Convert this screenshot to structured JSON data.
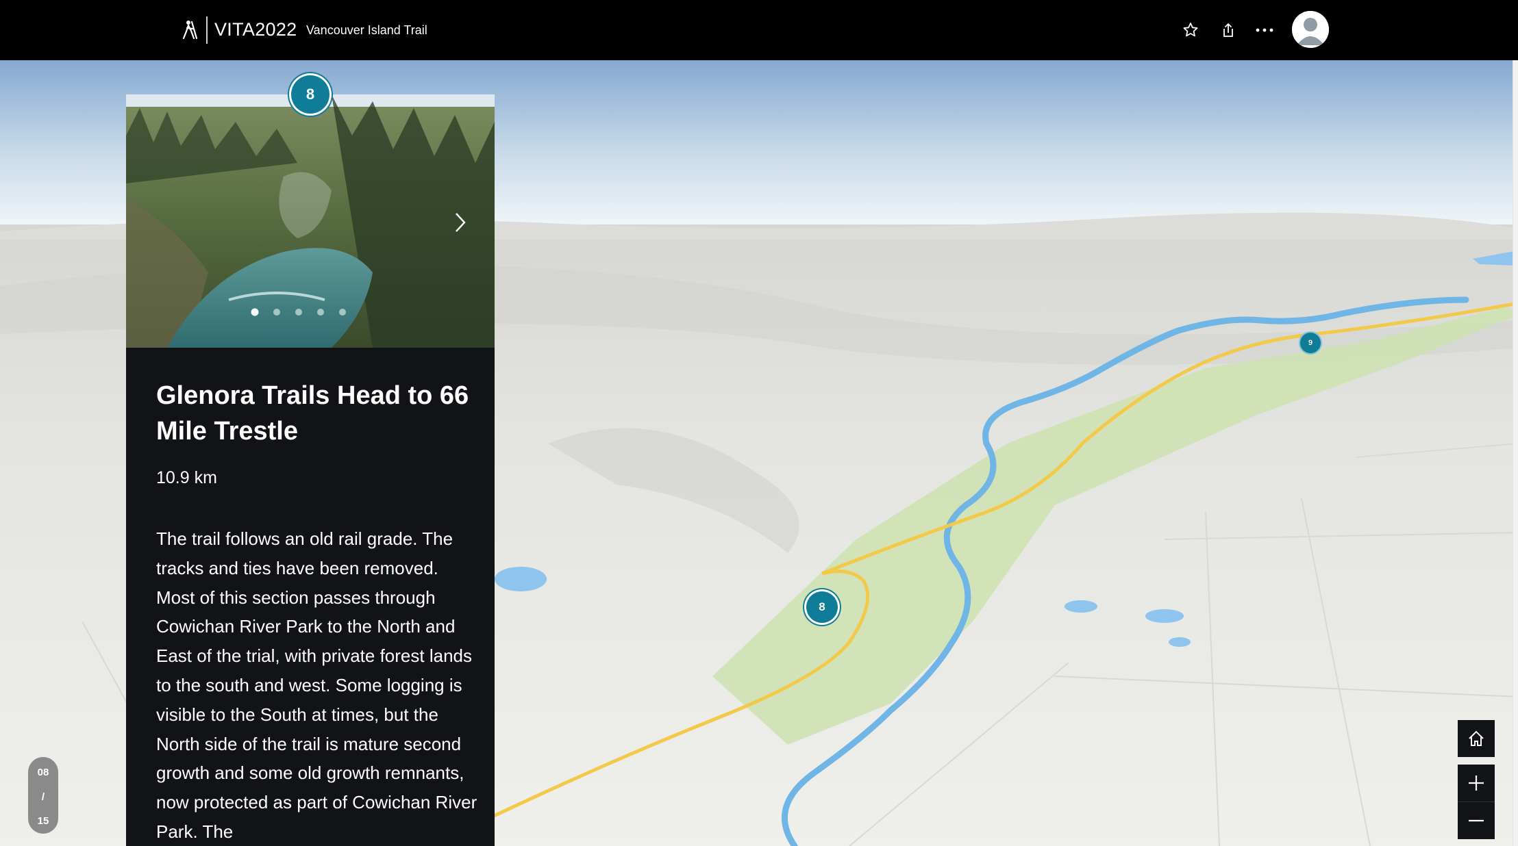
{
  "header": {
    "title": "VITA2022",
    "subtitle": "Vancouver Island Trail",
    "icons": [
      "hiker-logo-icon",
      "star-icon",
      "share-icon",
      "more-icon",
      "avatar"
    ]
  },
  "panel": {
    "title": "Glenora Trails Head to 66 Mile Trestle",
    "distance": "10.9 km",
    "body": "The trail follows an old rail grade. The tracks and ties have been removed. Most of this section passes through Cowichan River Park to the North and East of the trial, with private forest lands to the south and west. Some logging is visible to the South at times, but the North side of the trail is mature second growth and some old growth remnants, now protected as part of Cowichan River Park. The",
    "stop_number": "8",
    "carousel": {
      "count": 5,
      "active": 0
    }
  },
  "map": {
    "markers": [
      {
        "label": "8"
      },
      {
        "label": "9"
      }
    ],
    "colors": {
      "river": "#6fb6e6",
      "route": "#f3c94a",
      "park": "#cfe2b0",
      "terrain": "#ecece8",
      "sky_top": "#86a9d0"
    }
  },
  "counter": {
    "current": "08",
    "separator": "/",
    "total": "15"
  },
  "controls": {
    "icons": [
      "home-icon",
      "plus-icon",
      "minus-icon"
    ]
  },
  "colors": {
    "header_bg": "#000000",
    "panel_bg": "#111317",
    "marker": "#0f7c98"
  }
}
